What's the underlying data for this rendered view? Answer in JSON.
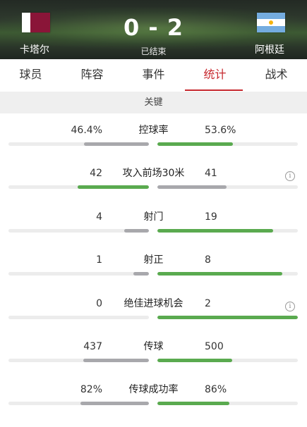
{
  "match": {
    "home_team": "卡塔尔",
    "away_team": "阿根廷",
    "score": "0 - 2",
    "status": "已结束"
  },
  "tabs": [
    {
      "label": "球员",
      "active": false
    },
    {
      "label": "阵容",
      "active": false
    },
    {
      "label": "事件",
      "active": false
    },
    {
      "label": "统计",
      "active": true
    },
    {
      "label": "战术",
      "active": false
    }
  ],
  "section_title": "关键",
  "colors": {
    "accent": "#c6282e",
    "winner_bar": "#5aaa4f",
    "loser_bar": "#a8a8ac"
  },
  "stats": [
    {
      "label": "控球率",
      "home": "46.4%",
      "away": "53.6%",
      "home_ratio": 0.464,
      "away_ratio": 0.536,
      "home_color": "grey",
      "away_color": "green",
      "info": false
    },
    {
      "label": "攻入前场30米",
      "home": "42",
      "away": "41",
      "home_ratio": 0.506,
      "away_ratio": 0.494,
      "home_color": "green",
      "away_color": "grey",
      "info": true
    },
    {
      "label": "射门",
      "home": "4",
      "away": "19",
      "home_ratio": 0.174,
      "away_ratio": 0.826,
      "home_color": "grey",
      "away_color": "green",
      "info": false
    },
    {
      "label": "射正",
      "home": "1",
      "away": "8",
      "home_ratio": 0.111,
      "away_ratio": 0.889,
      "home_color": "grey",
      "away_color": "green",
      "info": false
    },
    {
      "label": "绝佳进球机会",
      "home": "0",
      "away": "2",
      "home_ratio": 0.0,
      "away_ratio": 1.0,
      "home_color": "grey",
      "away_color": "green",
      "info": true
    },
    {
      "label": "传球",
      "home": "437",
      "away": "500",
      "home_ratio": 0.466,
      "away_ratio": 0.534,
      "home_color": "grey",
      "away_color": "green",
      "info": false
    },
    {
      "label": "传球成功率",
      "home": "82%",
      "away": "86%",
      "home_ratio": 0.488,
      "away_ratio": 0.512,
      "home_color": "grey",
      "away_color": "green",
      "info": false
    }
  ],
  "info_icon": "i"
}
